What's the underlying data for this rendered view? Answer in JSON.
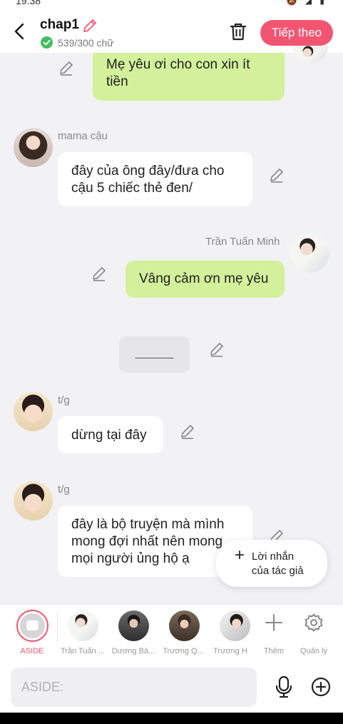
{
  "status": {
    "time": "19:38",
    "icons": "🔕 ◢ ▮"
  },
  "header": {
    "title": "chap1",
    "word_count": "539/300 chữ",
    "next_button": "Tiếp theo"
  },
  "messages": [
    {
      "sender": "",
      "text_lines": [
        "Mẹ yêu ơi cho con xin ít",
        "tiền"
      ]
    },
    {
      "sender": "mama cậu",
      "text_lines": [
        "đây của ông đây/đưa cho",
        "cậu 5 chiếc thẻ đen/"
      ]
    },
    {
      "sender": "Trần Tuấn Minh",
      "text_lines": [
        "Vâng cảm ơn mẹ yêu"
      ]
    },
    {
      "sender": "",
      "text_lines": [
        "______"
      ]
    },
    {
      "sender": "t/g",
      "text_lines": [
        "dừng tại đây"
      ]
    },
    {
      "sender": "t/g",
      "text_lines": [
        "đây là bộ truyện mà mình",
        "mong đợi nhất nên mong",
        "mọi người ủng hộ ạ"
      ]
    }
  ],
  "author_note": {
    "icon": "+",
    "line1": "Lời nhắn",
    "line2": "của tác giả"
  },
  "character_bar": {
    "aside_label": "ASIDE",
    "characters": [
      "Trần Tuấn ...",
      "Dương Bá...",
      "Trương Q...",
      "Trương H"
    ],
    "more_label": "Thêm",
    "manage_label": "Quản lý"
  },
  "composer": {
    "placeholder": "ASIDE:"
  },
  "colors": {
    "accent": "#f25572",
    "bubble_green": "#d3f09b",
    "check_green": "#3fbf5f"
  }
}
